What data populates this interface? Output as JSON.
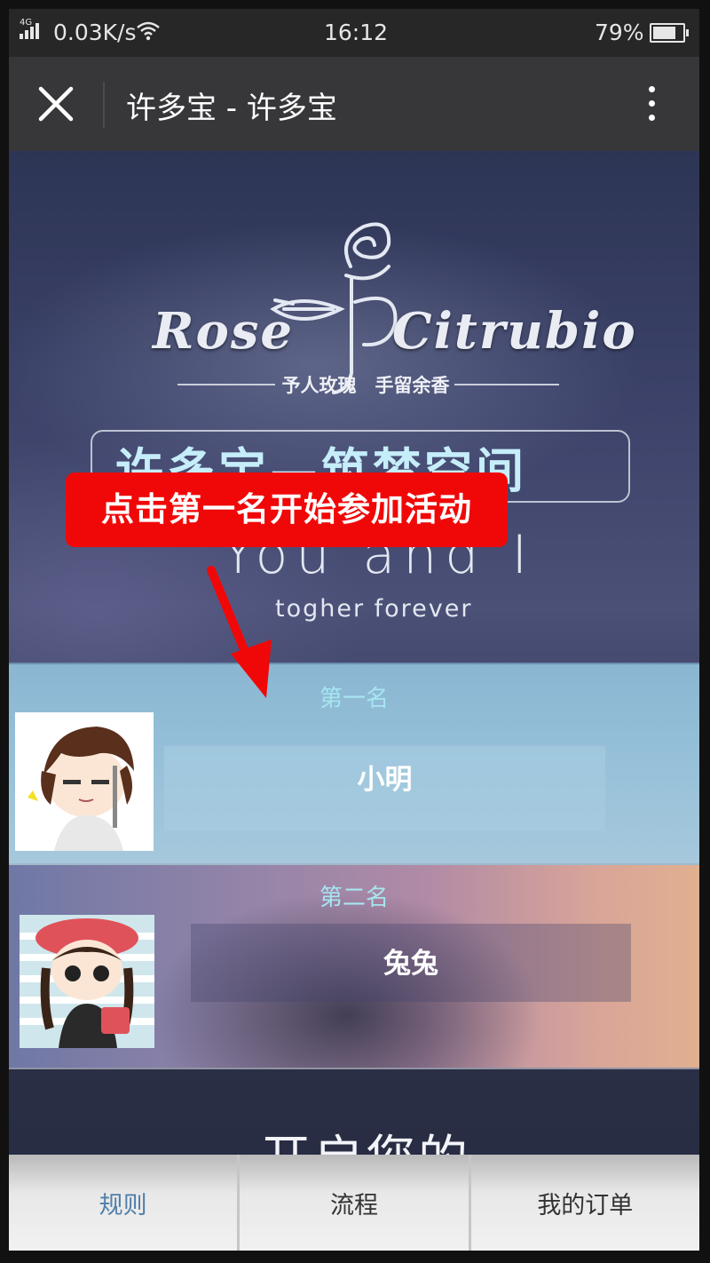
{
  "status_bar": {
    "network": "4G",
    "speed": "0.03K/s",
    "time": "16:12",
    "battery": "79%",
    "battery_level": 0.79
  },
  "title_bar": {
    "title": "许多宝 - 许多宝"
  },
  "hero": {
    "brand_left": "Rose",
    "brand_right": "Citrubio",
    "tagline": "予人玫瑰　手留余香",
    "banner": "许多宝—筑梦空间",
    "you_and_i": "You and I",
    "forever": "togher forever"
  },
  "callout": {
    "text": "点击第一名开始参加活动",
    "color": "#f00808"
  },
  "rankings": [
    {
      "label": "第一名",
      "name": "小明"
    },
    {
      "label": "第二名",
      "name": "兔兔"
    }
  ],
  "open_text": "开启您的",
  "tabs": [
    {
      "label": "规则",
      "active": true
    },
    {
      "label": "流程",
      "active": false
    },
    {
      "label": "我的订单",
      "active": false
    }
  ],
  "colors": {
    "accent_tab": "#4f7fa8",
    "title_bar": "#37373a",
    "rank_label": "#a6e6f0"
  }
}
